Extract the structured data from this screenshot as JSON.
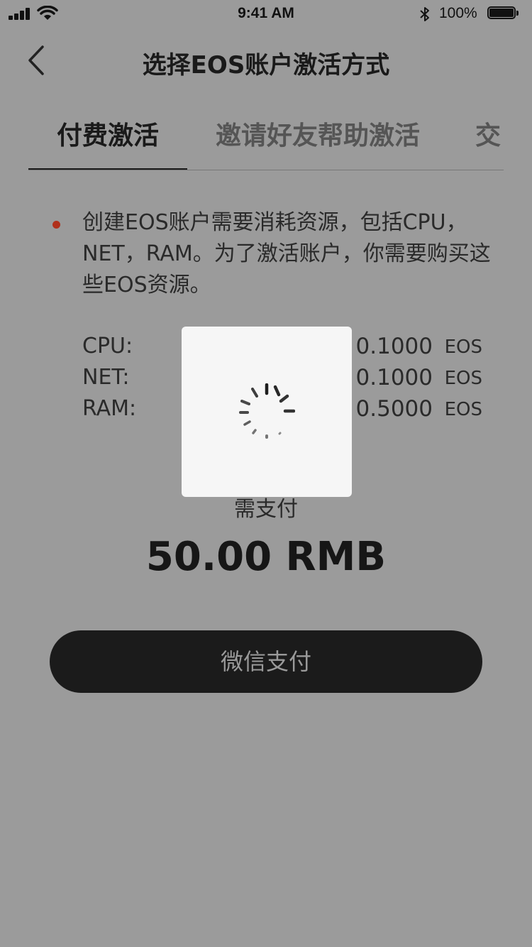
{
  "status_bar": {
    "time": "9:41 AM",
    "battery_percent": "100%",
    "icons": [
      "signal-icon",
      "wifi-icon",
      "bluetooth-icon",
      "battery-icon"
    ]
  },
  "nav": {
    "back_icon": "chevron-left-icon",
    "title": "选择EOS账户激活方式"
  },
  "tabs": [
    {
      "label": "付费激活",
      "active": true
    },
    {
      "label": "邀请好友帮助激活",
      "active": false
    },
    {
      "label": "交",
      "active": false
    }
  ],
  "notice": {
    "text": "创建EOS账户需要消耗资源，包括CPU，NET，RAM。为了激活账户，你需要购买这些EOS资源。",
    "bullet_color": "#b0301b"
  },
  "resources": [
    {
      "name": "CPU:",
      "value": "0.1000",
      "unit": "EOS"
    },
    {
      "name": "NET:",
      "value": "0.1000",
      "unit": "EOS"
    },
    {
      "name": "RAM:",
      "value": "0.5000",
      "unit": "EOS"
    }
  ],
  "payment": {
    "label": "需支付",
    "amount": "50.00 RMB",
    "button_label": "微信支付"
  },
  "loading": {
    "icon": "spinner-icon"
  },
  "colors": {
    "overlay_background": "#9b9b9b",
    "button_background": "#1b1b1b",
    "loading_panel": "#f6f6f6"
  }
}
